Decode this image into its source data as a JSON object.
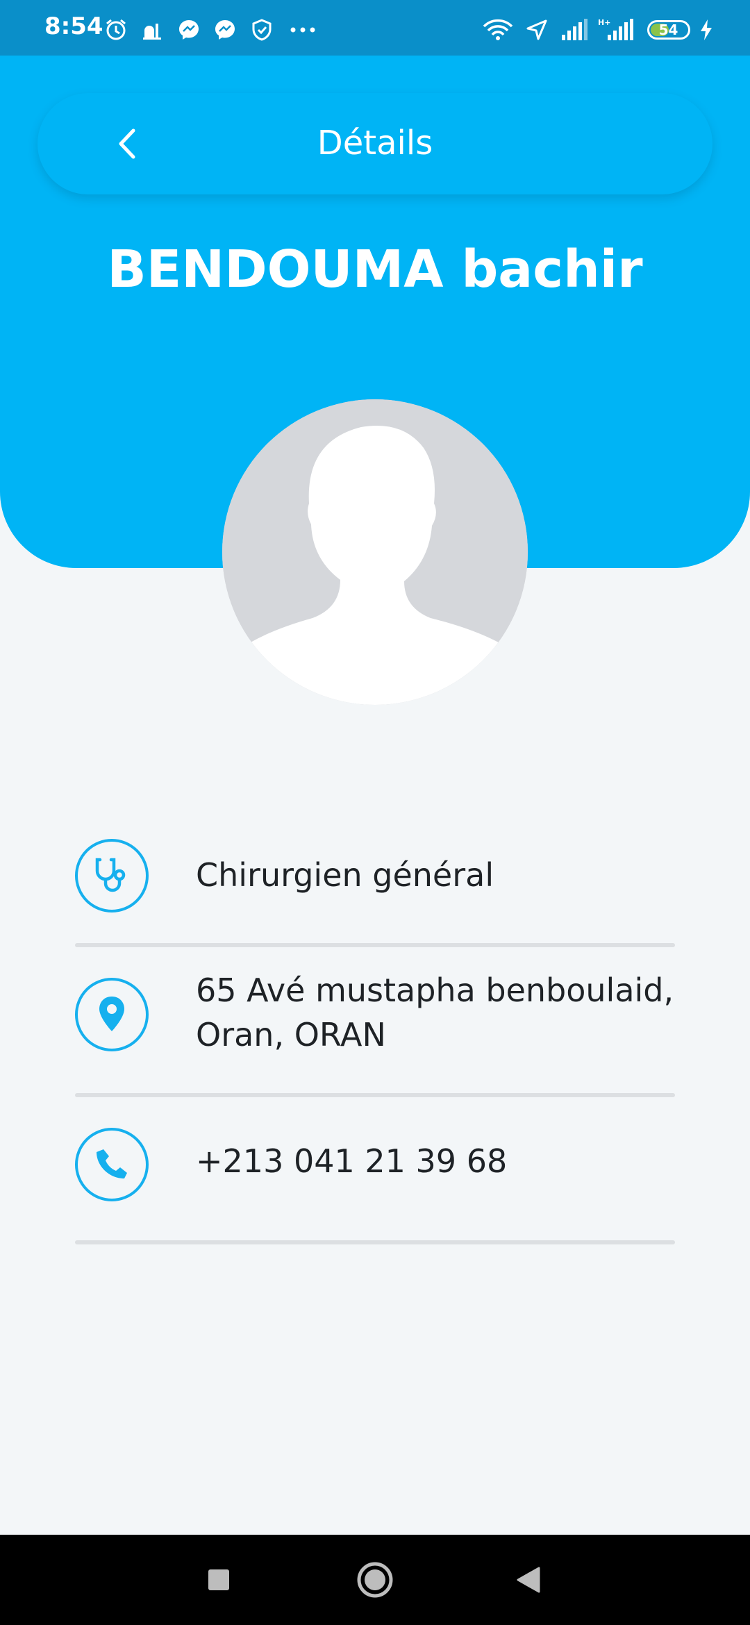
{
  "status_bar": {
    "time": "8:54",
    "battery_level": "54",
    "battery_fraction": 0.54,
    "left_icons": [
      "alarm-icon",
      "mosque-icon",
      "messenger-icon",
      "messenger-icon",
      "shield-icon",
      "more-dots-icon"
    ],
    "right_icons": [
      "wifi-icon",
      "location-arrow-icon",
      "signal-icon",
      "signal-h-plus-icon",
      "battery-icon",
      "charging-icon"
    ]
  },
  "header": {
    "title": "Détails",
    "back_icon": "chevron-left-icon"
  },
  "doctor": {
    "name": "BENDOUMA bachir",
    "avatar_icon": "default-avatar-silhouette"
  },
  "details": [
    {
      "icon": "stethoscope-icon",
      "text": "Chirurgien général"
    },
    {
      "icon": "location-pin-icon",
      "line1": "65 Avé mustapha benboulaid,",
      "line2": "Oran, ORAN"
    },
    {
      "icon": "phone-icon",
      "text": "+213 041 21 39 68"
    }
  ],
  "nav_bar": {
    "buttons": [
      "recent-apps-icon",
      "home-icon",
      "back-triangle-icon"
    ]
  },
  "colors": {
    "accent": "#00B4F5",
    "status_bar": "#0A8FC9",
    "background": "#F3F6F8",
    "icon_stroke": "#16B0EE",
    "text": "#1E2226",
    "divider": "#DCDFE2"
  }
}
